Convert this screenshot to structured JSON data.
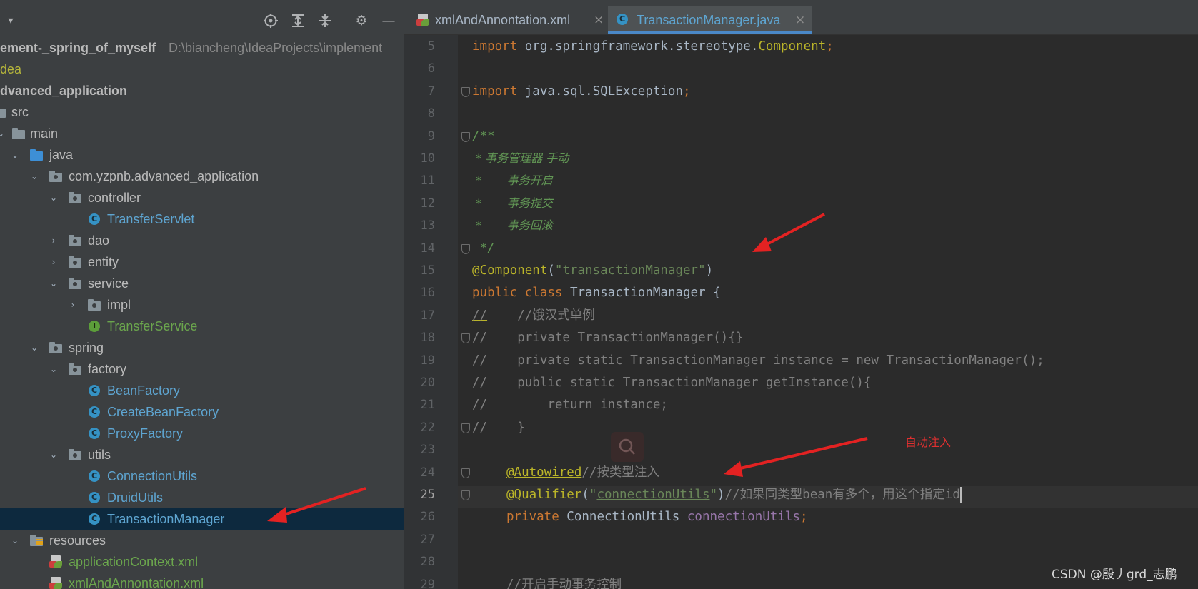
{
  "project_panel": {
    "root_label": "ement-_spring_of_myself",
    "root_path": "D:\\biancheng\\IdeaProjects\\implement",
    "items": [
      {
        "label": "dea"
      },
      {
        "label": "dvanced_application"
      },
      {
        "label": "src"
      },
      {
        "label": "main"
      },
      {
        "label": "java"
      },
      {
        "label": "com.yzpnb.advanced_application"
      },
      {
        "label": "controller"
      },
      {
        "label": "TransferServlet"
      },
      {
        "label": "dao"
      },
      {
        "label": "entity"
      },
      {
        "label": "service"
      },
      {
        "label": "impl"
      },
      {
        "label": "TransferService"
      },
      {
        "label": "spring"
      },
      {
        "label": "factory"
      },
      {
        "label": "BeanFactory"
      },
      {
        "label": "CreateBeanFactory"
      },
      {
        "label": "ProxyFactory"
      },
      {
        "label": "utils"
      },
      {
        "label": "ConnectionUtils"
      },
      {
        "label": "DruidUtils"
      },
      {
        "label": "TransactionManager"
      },
      {
        "label": "resources"
      },
      {
        "label": "applicationContext.xml"
      },
      {
        "label": "xmlAndAnnontation.xml"
      }
    ]
  },
  "tabs": [
    {
      "label": "xmlAndAnnontation.xml",
      "active": false
    },
    {
      "label": "TransactionManager.java",
      "active": true
    }
  ],
  "editor": {
    "current_line": "25",
    "lines": [
      {
        "n": "5",
        "a": "import",
        "b": " org.springframework.stereotype.",
        "c": "Component",
        "d": ";"
      },
      {
        "n": "6"
      },
      {
        "n": "7",
        "a": "import",
        "b": " java.sql.SQLException",
        "c": ";"
      },
      {
        "n": "8"
      },
      {
        "n": "9",
        "a": "/**"
      },
      {
        "n": "10",
        "a": " * 事务管理器 手动"
      },
      {
        "n": "11",
        "a": " *       事务开启"
      },
      {
        "n": "12",
        "a": " *       事务提交"
      },
      {
        "n": "13",
        "a": " *       事务回滚"
      },
      {
        "n": "14",
        "a": " */"
      },
      {
        "n": "15",
        "a": "@Component",
        "b": "(",
        "c": "\"transactionManager\"",
        "d": ")"
      },
      {
        "n": "16",
        "a": "public class",
        "b": " TransactionManager {"
      },
      {
        "n": "17",
        "a": "//",
        "b": "    //饿汉式单例"
      },
      {
        "n": "18",
        "a": "//    private TransactionManager(){}"
      },
      {
        "n": "19",
        "a": "//    private static TransactionManager instance = new TransactionManager();"
      },
      {
        "n": "20",
        "a": "//    public static TransactionManager getInstance(){"
      },
      {
        "n": "21",
        "a": "//        return instance;"
      },
      {
        "n": "22",
        "a": "//    }"
      },
      {
        "n": "23"
      },
      {
        "n": "24",
        "a": "@Autowired",
        "b": "//按类型注入"
      },
      {
        "n": "25",
        "a": "@Qualifier",
        "b": "(",
        "c": "\"",
        "d": "connectionUtils",
        "e": "\"",
        "f": ")",
        "g": "//如果同类型bean有多个，用这个指定id"
      },
      {
        "n": "26",
        "a": "private",
        "b": " ConnectionUtils ",
        "c": "connectionUtils",
        "d": ";"
      },
      {
        "n": "27"
      },
      {
        "n": "28"
      },
      {
        "n": "29",
        "a": "//开启手动事务控制"
      }
    ]
  },
  "annotation_note": "自动注入",
  "watermark": "CSDN @殷丿grd_志鹏",
  "icons": [
    "dropdown-chevron-icon",
    "locate-icon",
    "expand-all-icon",
    "collapse-all-icon",
    "gear-icon",
    "minimize-icon",
    "folder-icon",
    "package-icon",
    "class-icon",
    "interface-icon",
    "xml-file-icon",
    "close-icon",
    "fold-marker-icon",
    "search-icon",
    "red-arrow-icon"
  ],
  "colors": {
    "keyword": "#cc7832",
    "annotation": "#bbb529",
    "string": "#6a8759",
    "comment": "#808080",
    "doc_comment": "#629755",
    "field": "#9876aa",
    "class_file": "#5ea5d1",
    "selection": "#0d293e",
    "arrow": "#e32222"
  }
}
